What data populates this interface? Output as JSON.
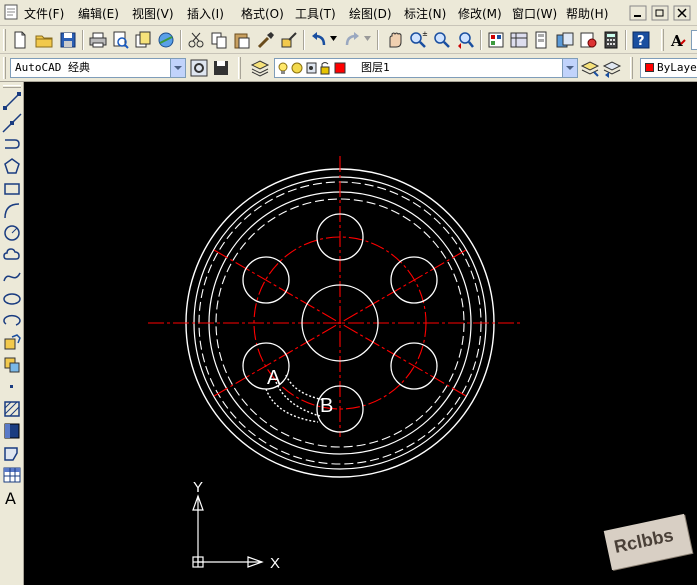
{
  "menubar": {
    "items": [
      {
        "label": "文件(F)"
      },
      {
        "label": "编辑(E)"
      },
      {
        "label": "视图(V)"
      },
      {
        "label": "插入(I)"
      },
      {
        "label": "格式(O)"
      },
      {
        "label": "工具(T)"
      },
      {
        "label": "绘图(D)"
      },
      {
        "label": "标注(N)"
      },
      {
        "label": "修改(M)"
      },
      {
        "label": "窗口(W)"
      },
      {
        "label": "帮助(H)"
      }
    ]
  },
  "toolbar2": {
    "workspace_value": "AutoCAD 经典",
    "layer_value": "图层1",
    "layer_color": "#ff0000",
    "linetype_value": "ByLaye"
  },
  "drawing": {
    "point_a_label": "A",
    "point_b_label": "B",
    "ucs_x_label": "X",
    "ucs_y_label": "Y",
    "watermark": "Rclbbs",
    "colors": {
      "geometry": "#ffffff",
      "centerline": "#ff0000",
      "background": "#000000"
    }
  }
}
